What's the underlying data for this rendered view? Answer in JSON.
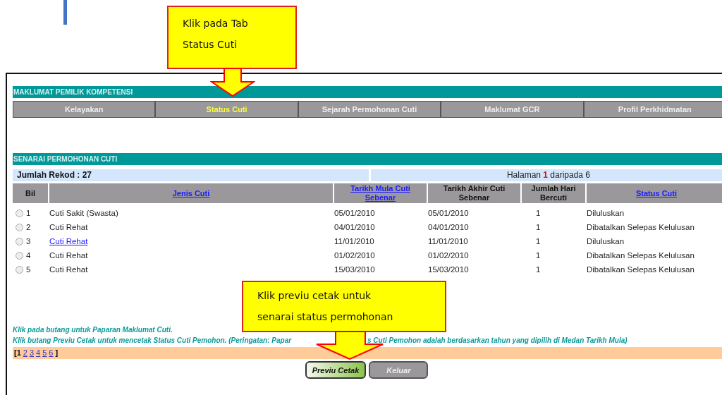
{
  "callouts": [
    {
      "lines": [
        "Klik pada Tab",
        "Status Cuti"
      ]
    },
    {
      "lines": [
        "Klik previu cetak untuk",
        "senarai status permohonan"
      ]
    }
  ],
  "section_title": "MAKLUMAT PEMILIK KOMPETENSI",
  "tabs": [
    {
      "label": "Kelayakan",
      "selected": false
    },
    {
      "label": "Status Cuti",
      "selected": true
    },
    {
      "label": "Sejarah Permohonan Cuti",
      "selected": false
    },
    {
      "label": "Maklumat GCR",
      "selected": false
    },
    {
      "label": "Profil Perkhidmatan",
      "selected": false
    }
  ],
  "list_title": "SENARAI PERMOHONAN CUTI",
  "record_count": "Jumlah Rekod : 27",
  "page_info": "Halaman **1** daripada 6",
  "columns": [
    {
      "label": "Bil",
      "link": false
    },
    {
      "label": "Jenis Cuti",
      "link": true
    },
    {
      "label": "Tarikh Mula Cuti Sebenar",
      "link": true
    },
    {
      "label": "Tarikh Akhir Cuti Sebenar",
      "link": false
    },
    {
      "label": "Jumlah Hari Bercuti",
      "link": false
    },
    {
      "label": "Status Cuti",
      "link": true
    }
  ],
  "rows": [
    {
      "bil": "1",
      "selected": false,
      "jenis": "Cuti Sakit (Swasta)",
      "link": false,
      "mula": "05/01/2010",
      "akhir": "05/01/2010",
      "jumlah": "1",
      "status": "Diluluskan"
    },
    {
      "bil": "2",
      "selected": false,
      "jenis": "Cuti Rehat",
      "link": false,
      "mula": "04/01/2010",
      "akhir": "04/01/2010",
      "jumlah": "1",
      "status": "Dibatalkan Selepas Kelulusan"
    },
    {
      "bil": "3",
      "selected": false,
      "jenis": "Cuti Rehat",
      "link": true,
      "mula": "11/01/2010",
      "akhir": "11/01/2010",
      "jumlah": "1",
      "status": "Diluluskan"
    },
    {
      "bil": "4",
      "selected": false,
      "jenis": "Cuti Rehat",
      "link": false,
      "mula": "01/02/2010",
      "akhir": "01/02/2010",
      "jumlah": "1",
      "status": "Dibatalkan Selepas Kelulusan"
    },
    {
      "bil": "5",
      "selected": false,
      "jenis": "Cuti Rehat",
      "link": false,
      "mula": "15/03/2010",
      "akhir": "15/03/2010",
      "jumlah": "1",
      "status": "Dibatalkan Selepas Kelulusan"
    }
  ],
  "notes": [
    {
      "segments": [
        "Klik pada butang untuk Paparan Maklumat Cuti."
      ]
    },
    {
      "segments": [
        "Klik butang Previu Cetak untuk mencetak Status Cuti Pemohon. (Peringatan: Papar",
        "s Cuti Pemohon adalah berdasarkan tahun yang dipilih di Medan Tarikh Mula)"
      ]
    }
  ],
  "pager": {
    "open": "[",
    "close": "]",
    "pages": [
      {
        "label": "1",
        "selected": true
      },
      {
        "label": "2",
        "selected": false
      },
      {
        "label": "3",
        "selected": false
      },
      {
        "label": "4",
        "selected": false
      },
      {
        "label": "5",
        "selected": false
      },
      {
        "label": "6",
        "selected": false
      }
    ]
  },
  "buttons": [
    {
      "label": "Previu Cetak",
      "kind": "primary"
    },
    {
      "label": "Keluar",
      "kind": "secondary"
    }
  ]
}
